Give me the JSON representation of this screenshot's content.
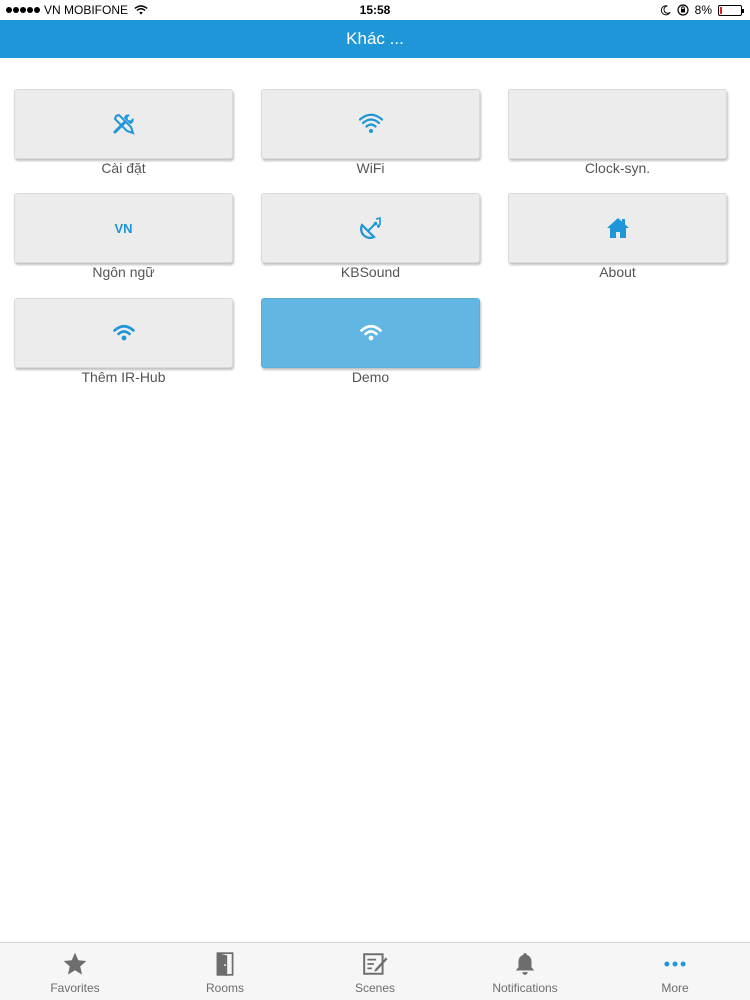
{
  "status_bar": {
    "carrier": "VN MOBIFONE",
    "time": "15:58",
    "battery": "8%",
    "battery_level": 0.08
  },
  "header": {
    "title": "Khác ..."
  },
  "tiles": [
    {
      "label": "Cài đặt",
      "icon": "tools-icon",
      "active": false
    },
    {
      "label": "WiFi",
      "icon": "wifi-icon",
      "active": false
    },
    {
      "label": "Clock-syn.",
      "icon": "",
      "active": false
    },
    {
      "label": "Ngôn ngữ",
      "icon": "vn-text",
      "icon_text": "VN",
      "active": false
    },
    {
      "label": "KBSound",
      "icon": "satellite-icon",
      "active": false
    },
    {
      "label": "About",
      "icon": "home-icon",
      "active": false
    },
    {
      "label": "Thêm IR-Hub",
      "icon": "wifi-icon",
      "active": false
    },
    {
      "label": "Demo",
      "icon": "wifi-icon",
      "active": true
    }
  ],
  "tabbar": {
    "items": [
      {
        "label": "Favorites",
        "icon": "star-icon"
      },
      {
        "label": "Rooms",
        "icon": "door-icon"
      },
      {
        "label": "Scenes",
        "icon": "scenes-icon"
      },
      {
        "label": "Notifications",
        "icon": "bell-icon"
      },
      {
        "label": "More",
        "icon": "more-icon"
      }
    ]
  },
  "colors": {
    "accent": "#1e96d8",
    "active_tile": "#62b6e2",
    "tile_bg": "#ececec"
  }
}
